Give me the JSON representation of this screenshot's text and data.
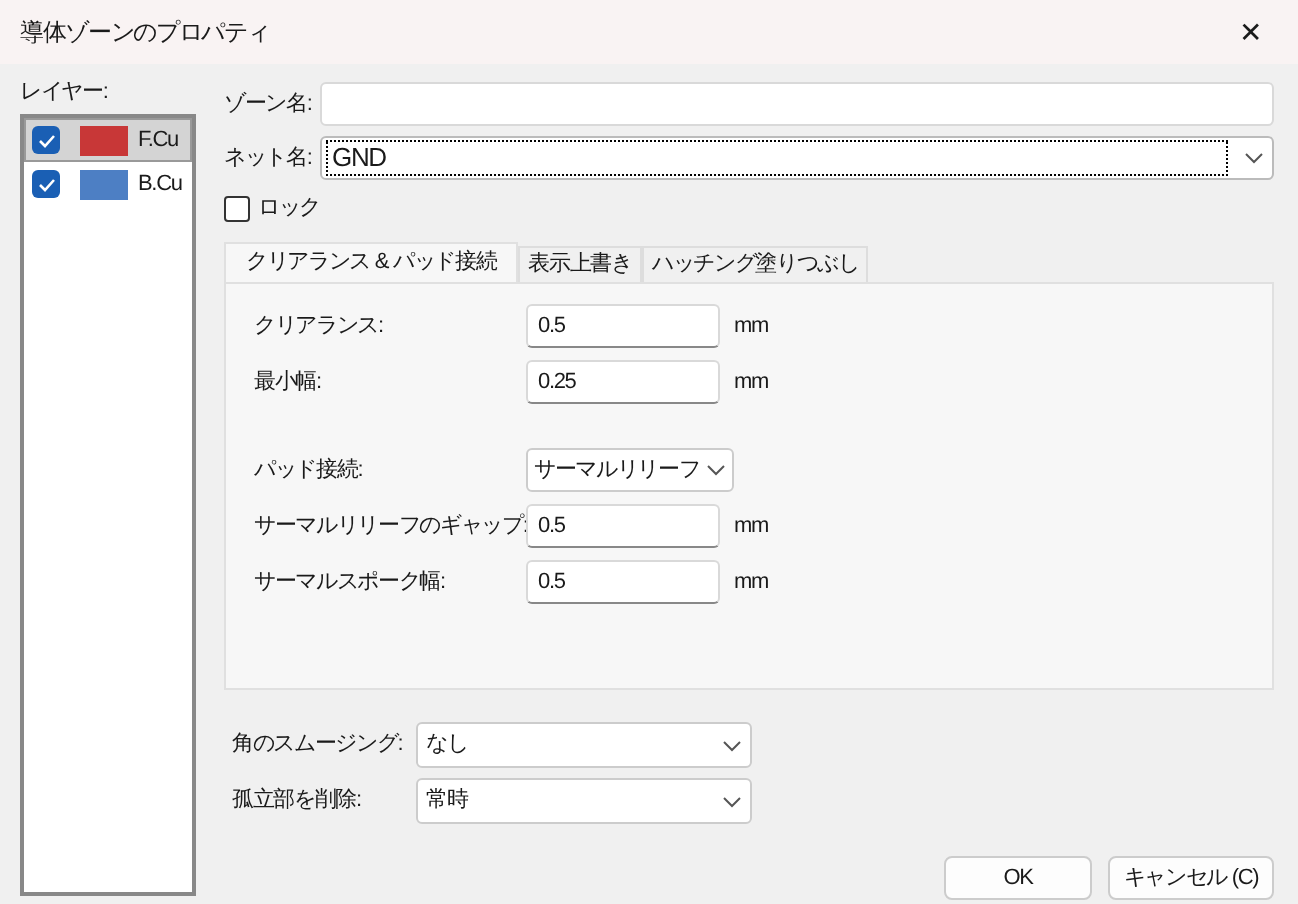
{
  "window": {
    "title": "導体ゾーンのプロパティ",
    "close": "✕"
  },
  "layers": {
    "label": "レイヤー:",
    "items": [
      {
        "name": "F.Cu",
        "checked": true,
        "selected": true,
        "color": "#c83737"
      },
      {
        "name": "B.Cu",
        "checked": true,
        "selected": false,
        "color": "#4d7fc4"
      }
    ]
  },
  "zone_name": {
    "label": "ゾーン名:"
  },
  "net_name": {
    "label": "ネット名:",
    "value": "GND"
  },
  "lock": {
    "label": "ロック",
    "checked": false
  },
  "tabs": [
    {
      "label": "クリアランス & パッド接続",
      "selected": true
    },
    {
      "label": "表示上書き",
      "selected": false
    },
    {
      "label": "ハッチング塗りつぶし",
      "selected": false
    }
  ],
  "settings": [
    {
      "kind": "input",
      "label": "クリアランス:",
      "value": "0.5",
      "unit": "mm"
    },
    {
      "kind": "input",
      "label": "最小幅:",
      "value": "0.25",
      "unit": "mm"
    },
    {
      "kind": "select",
      "label": "パッド接続:",
      "value": "サーマルリリーフ"
    },
    {
      "kind": "input",
      "label": "サーマルリリーフのギャップ:",
      "value": "0.5",
      "unit": "mm"
    },
    {
      "kind": "input",
      "label": "サーマルスポーク幅:",
      "value": "0.5",
      "unit": "mm"
    }
  ],
  "options": [
    {
      "label": "角のスムージング:",
      "value": "なし"
    },
    {
      "label": "孤立部を削除:",
      "value": "常時"
    }
  ],
  "buttons": [
    {
      "label": "OK"
    },
    {
      "label": "キャンセル (C)"
    }
  ]
}
